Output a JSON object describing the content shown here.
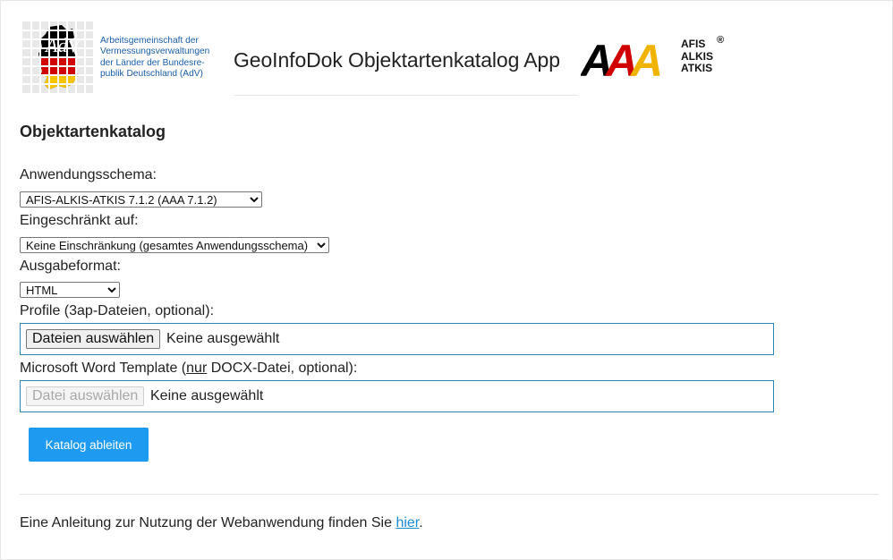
{
  "header": {
    "org_lines": [
      "Arbeitsgemeinschaft der",
      "Vermessungsverwaltungen",
      "der Länder der Bundesre-",
      "publik Deutschland (AdV)"
    ],
    "app_title": "GeoInfoDok Objektartenkatalog App",
    "aaa_logo": {
      "letters": "AAA",
      "words": [
        "AFIS",
        "ALKIS",
        "ATKIS"
      ],
      "registered": "®"
    },
    "adv_logo_letters": "AdV"
  },
  "form": {
    "section_title": "Objektartenkatalog",
    "schema": {
      "label": "Anwendungsschema:",
      "selected": "AFIS-ALKIS-ATKIS 7.1.2 (AAA 7.1.2)"
    },
    "restricted": {
      "label": "Eingeschränkt auf:",
      "selected": "Keine Einschränkung (gesamtes Anwendungsschema)"
    },
    "format": {
      "label": "Ausgabeformat:",
      "selected": "HTML"
    },
    "profiles": {
      "label": "Profile (3ap-Dateien, optional):",
      "button": "Dateien auswählen",
      "status": "Keine ausgewählt"
    },
    "word_template": {
      "label_prefix": "Microsoft Word Template (",
      "label_underlined": "nur",
      "label_suffix": " DOCX-Datei, optional):",
      "button": "Datei auswählen",
      "status": "Keine ausgewählt"
    },
    "submit_label": "Katalog ableiten"
  },
  "footer": {
    "text": "Eine Anleitung zur Nutzung der Webanwendung finden Sie ",
    "link": "hier",
    "end": "."
  },
  "colors": {
    "accent": "#1e9bf0",
    "link": "#1a8cd8",
    "adv_blue": "#1a5ea8",
    "file_border": "#2a86b5"
  }
}
